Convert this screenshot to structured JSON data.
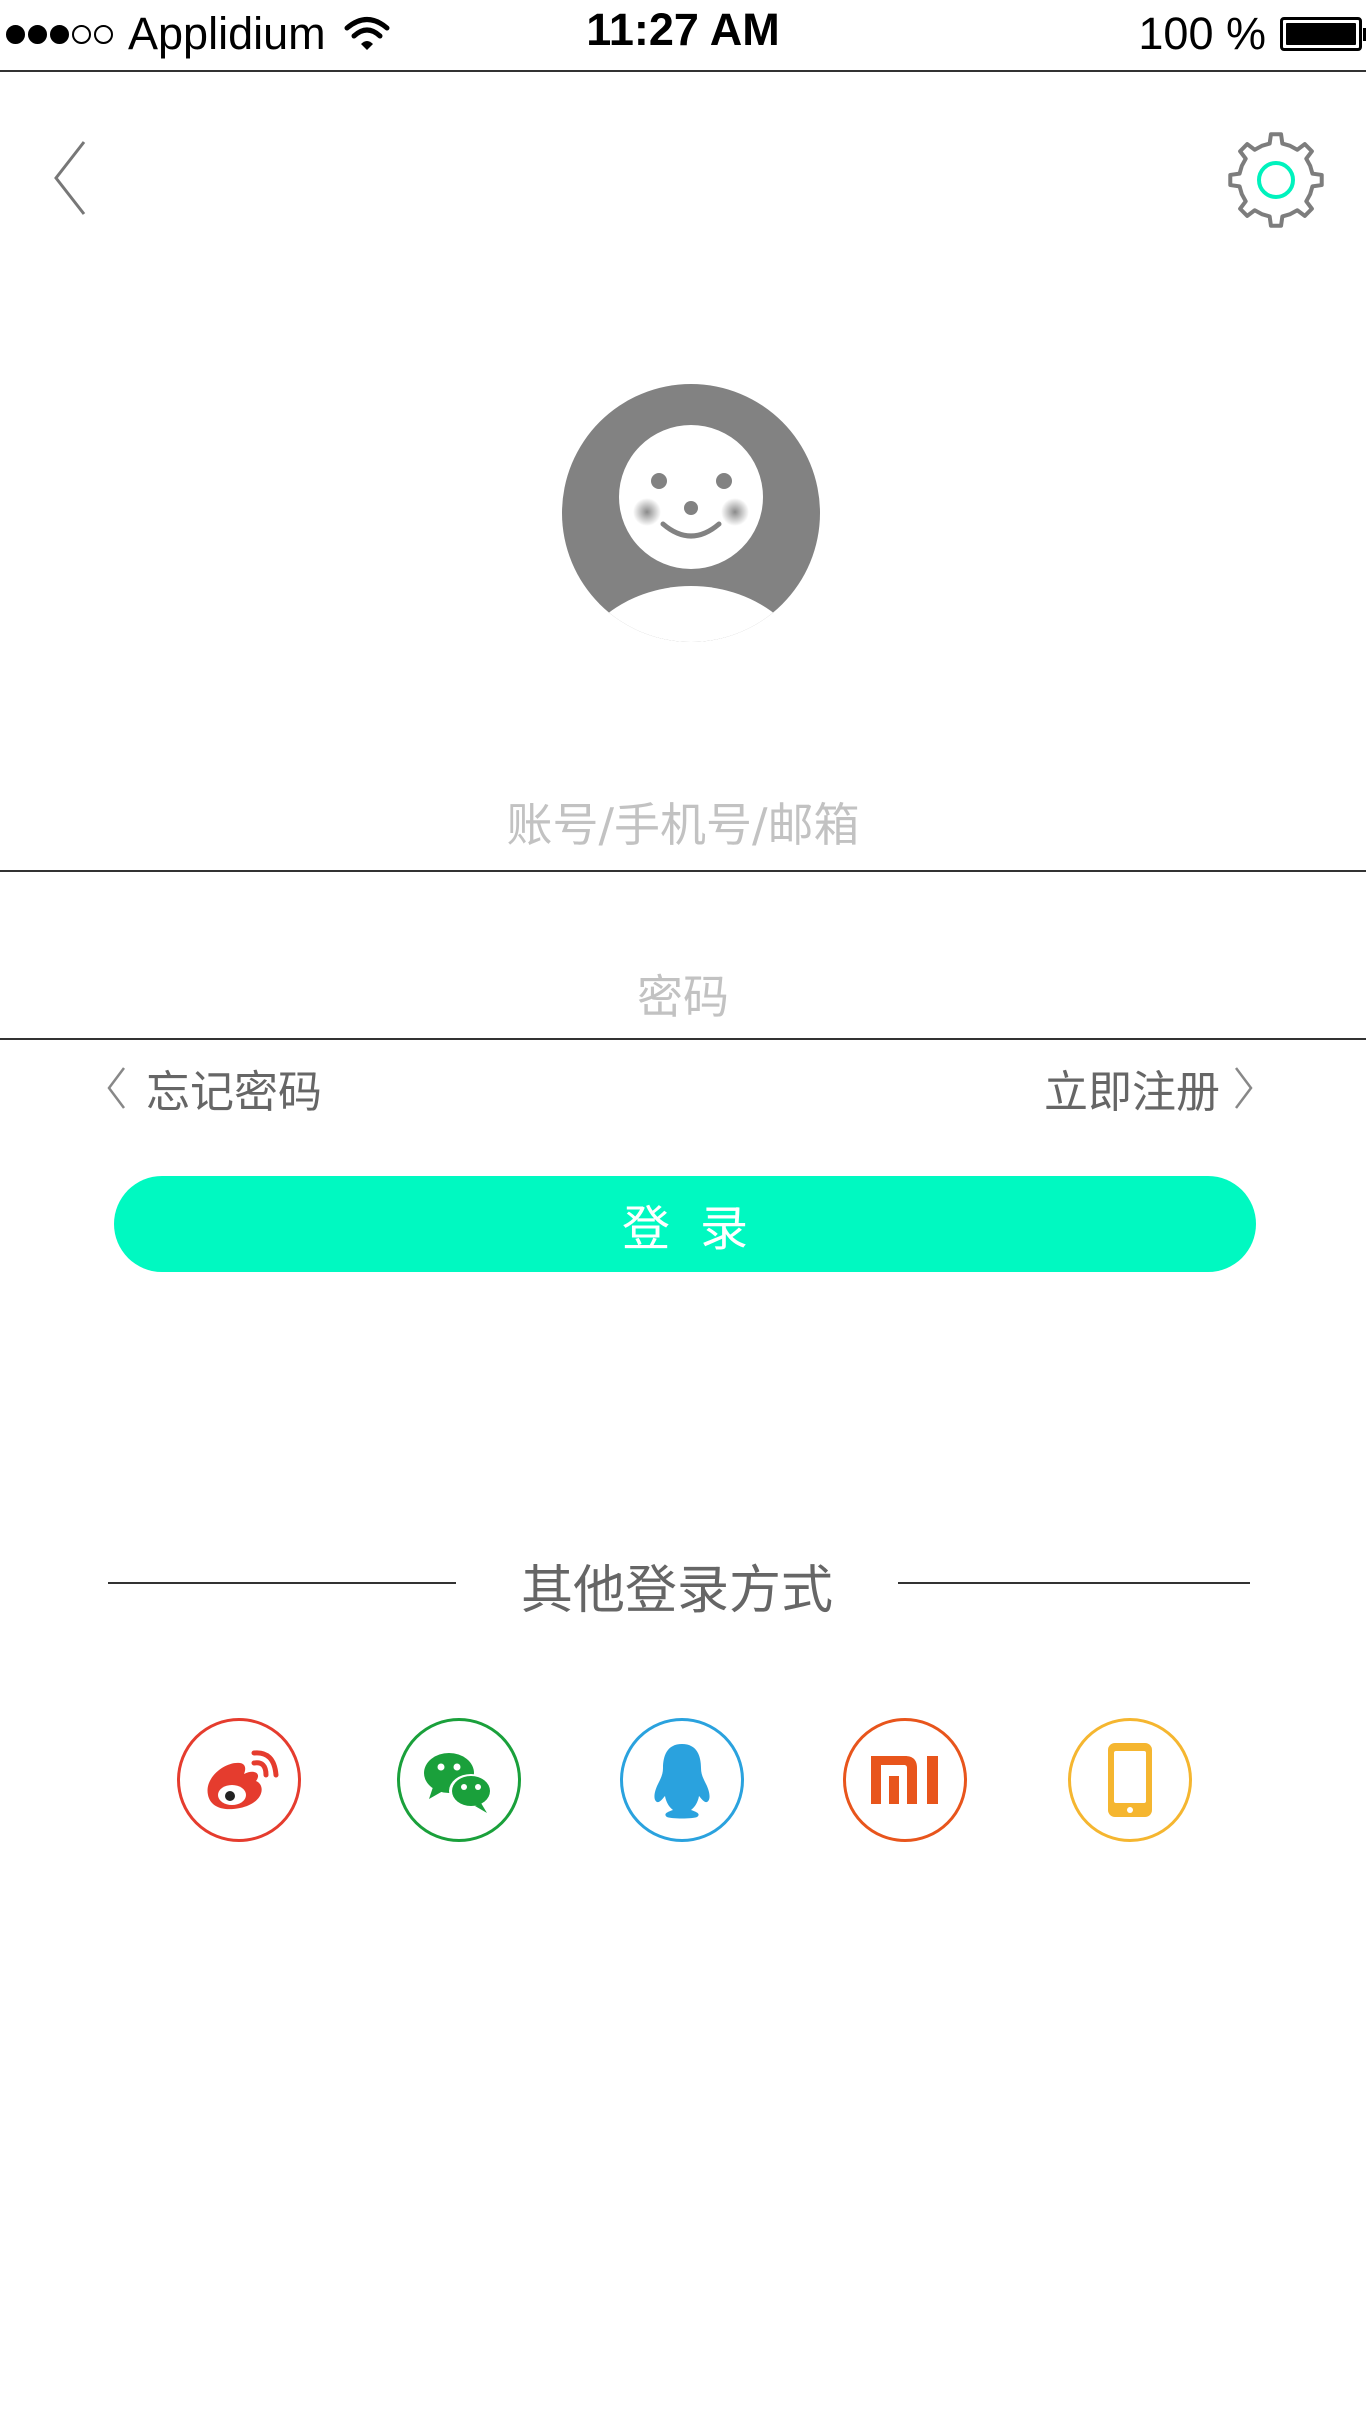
{
  "status_bar": {
    "carrier": "Applidium",
    "time": "11:27 AM",
    "battery_label": "100 %",
    "battery_level": 1.0,
    "signal_strength": 3,
    "signal_max": 5
  },
  "nav": {
    "back_icon": "chevron-left-icon",
    "settings_icon": "gear-icon"
  },
  "avatar": {
    "icon": "smiley-avatar-icon",
    "color": "#828282"
  },
  "form": {
    "account_placeholder": "账号/手机号/邮箱",
    "password_placeholder": "密码",
    "account_value": "",
    "password_value": ""
  },
  "links": {
    "forgot_password": "忘记密码",
    "register": "立即注册"
  },
  "login_button": {
    "label": "登录",
    "color": "#00f9c1"
  },
  "other_login": {
    "title": "其他登录方式",
    "providers": [
      {
        "icon": "weibo-icon",
        "color": "#e53c2e"
      },
      {
        "icon": "wechat-icon",
        "color": "#1aa03b"
      },
      {
        "icon": "qq-icon",
        "color": "#2aa2de"
      },
      {
        "icon": "xiaomi-icon",
        "color": "#e8551c"
      },
      {
        "icon": "phone-icon",
        "color": "#f5b630"
      }
    ]
  },
  "colors": {
    "accent": "#00f9c1",
    "divider": "#333333",
    "placeholder": "#c2c2c2",
    "secondary_text": "#666666"
  }
}
